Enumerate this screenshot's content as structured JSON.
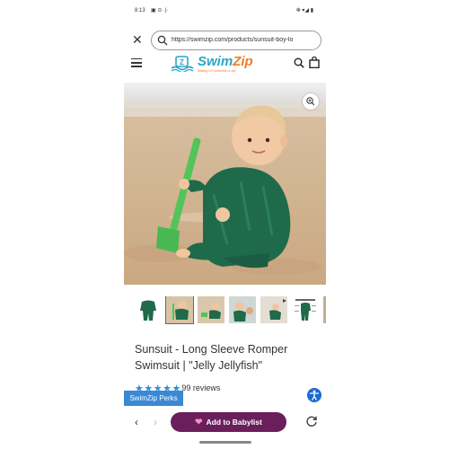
{
  "statusbar": {
    "time": "8:13",
    "left_icons": "▣ ⊙ ·|·",
    "right_icons": "✻ ▾◢ ▮"
  },
  "browser": {
    "url": "https://swimzip.com/products/sunsuit-boy-lo",
    "close_icon": "close-icon",
    "search_icon": "search-icon"
  },
  "site": {
    "logo_name": "SwimZip",
    "logo_first": "Swim",
    "logo_second": "Zip",
    "logo_tagline": "Making UV protection a zip!",
    "accent": "#2aa6c4",
    "logo_orange": "#f07b2c"
  },
  "product": {
    "title": "Sunsuit - Long Sleeve Romper Swimsuit | \"Jelly Jellyfish\"",
    "rating": 5,
    "reviews_label": "99 reviews",
    "star_color": "#2b8fd6"
  },
  "perks": {
    "label": "SwimZip Perks"
  },
  "bottom": {
    "babylist_label": "Add to Babylist",
    "babylist_color": "#6a1f5c"
  }
}
